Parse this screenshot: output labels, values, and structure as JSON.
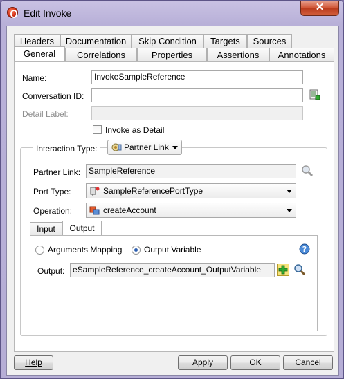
{
  "window": {
    "title": "Edit Invoke",
    "close_glyph": "✕"
  },
  "tabs": {
    "row1": [
      "Headers",
      "Documentation",
      "Skip Condition",
      "Targets",
      "Sources"
    ],
    "row2": [
      "General",
      "Correlations",
      "Properties",
      "Assertions",
      "Annotations"
    ],
    "selected": "General"
  },
  "form": {
    "name_label": "Name:",
    "name_value": "InvokeSampleReference",
    "conversation_label": "Conversation ID:",
    "conversation_value": "",
    "detail_label": "Detail Label:",
    "detail_value": "",
    "invoke_as_detail_label": "Invoke as Detail",
    "invoke_as_detail_checked": false
  },
  "interaction": {
    "type_label": "Interaction Type:",
    "type_value": "Partner Link",
    "partner_link_label": "Partner Link:",
    "partner_link_value": "SampleReference",
    "port_type_label": "Port Type:",
    "port_type_value": "SampleReferencePortType",
    "operation_label": "Operation:",
    "operation_value": "createAccount"
  },
  "io_tabs": {
    "items": [
      "Input",
      "Output"
    ],
    "selected": "Output"
  },
  "output": {
    "arguments_mapping_label": "Arguments Mapping",
    "output_variable_label": "Output Variable",
    "selected_mode": "Output Variable",
    "output_label": "Output:",
    "output_value": "eSampleReference_createAccount_OutputVariable"
  },
  "buttons": {
    "help": "Help",
    "apply": "Apply",
    "ok": "OK",
    "cancel": "Cancel"
  },
  "icons": {
    "app": "jdeveloper-app-icon",
    "browse": "magnifier-icon",
    "add": "green-plus-icon",
    "help": "blue-question-icon",
    "variable_picker": "variable-picker-icon",
    "partner_link_type": "partner-link-icon",
    "port_type": "port-type-icon",
    "operation": "operation-icon"
  },
  "colors": {
    "title_bar": "#c9c2e3",
    "close_button": "#cf5233",
    "selected_radio": "#2d5fb1",
    "add_icon": "#2fa82f"
  }
}
